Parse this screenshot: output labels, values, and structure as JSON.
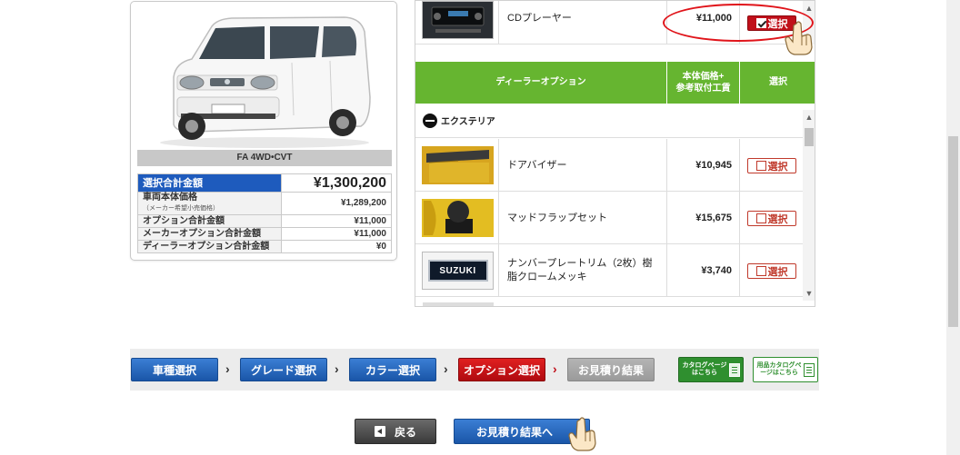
{
  "car": {
    "caption": "FA 4WD•CVT",
    "summary": {
      "total_label": "選択合計金額",
      "total_value": "¥1,300,200",
      "rows": [
        {
          "label": "車両本体価格",
          "sub": "（メーカー希望小売価格）",
          "value": "¥1,289,200"
        },
        {
          "label": "オプション合計金額",
          "value": "¥11,000"
        },
        {
          "label": "メーカーオプション合計金額",
          "value": "¥11,000"
        },
        {
          "label": "ディーラーオプション合計金額",
          "value": "¥0"
        }
      ]
    }
  },
  "maker_option": {
    "name": "CDプレーヤー",
    "price": "¥11,000",
    "select_label": "選択",
    "selected": true
  },
  "dealer": {
    "header": {
      "title": "ディーラーオプション",
      "price_col_line1": "本体価格+",
      "price_col_line2": "参考取付工賃",
      "select_col": "選択"
    },
    "category": "エクステリア",
    "items": [
      {
        "name": "ドアバイザー",
        "price": "¥10,945",
        "select_label": "選択"
      },
      {
        "name": "マッドフラップセット",
        "price": "¥15,675",
        "select_label": "選択"
      },
      {
        "name": "ナンバープレートリム（2枚）樹脂クロームメッキ",
        "price": "¥3,740",
        "select_label": "選択"
      }
    ],
    "emblem_text": "SUZUKI"
  },
  "steps": {
    "items": [
      "車種選択",
      "グレード選択",
      "カラー選択",
      "オプション選択",
      "お見積り結果"
    ],
    "catalog_label": "カタログページはこちら",
    "accessory_catalog_label": "用品カタログページはこちら"
  },
  "nav": {
    "back_label": "戻る",
    "next_label": "お見積り結果へ"
  },
  "colors": {
    "accent_blue": "#1a56a8",
    "active_red": "#c0101a",
    "dealer_green": "#66b530"
  }
}
